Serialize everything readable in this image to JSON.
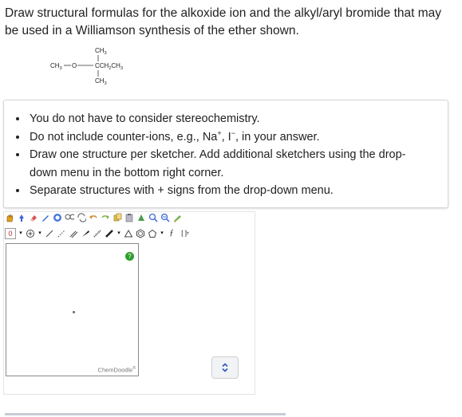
{
  "question": {
    "line1": "Draw structural formulas for the alkoxide ion and the alkyl/aryl bromide that may",
    "line2": "be used in a Williamson synthesis of the ether shown."
  },
  "molecule": {
    "top_label": "CH",
    "top_sub": "3",
    "left_label": "CH",
    "left_sub": "3",
    "oxygen": "O",
    "center_label_pre": "CCH",
    "center_sub1": "2",
    "center_label_post": "CH",
    "center_sub2": "3",
    "bottom_label": "CH",
    "bottom_sub": "3"
  },
  "instructions": {
    "items": [
      "You do not have to consider stereochemistry.",
      "Do not include counter-ions, e.g., Na",
      "Draw one structure per sketcher. Add additional sketchers using the drop-",
      "down menu in the bottom right corner.",
      "Separate structures with + signs from the drop-down menu."
    ],
    "item2_sup1": "+",
    "item2_mid": ", I",
    "item2_sup2": "−",
    "item2_end": ", in your answer."
  },
  "toolbar": {
    "row2_charge": "0",
    "row2_text_tool": "ƒ",
    "row2_bracket": "[ ]",
    "row2_bracket_sup": "±"
  },
  "sketcher": {
    "help": "?",
    "watermark": "ChemDoodle",
    "watermark_mark": "®"
  },
  "colors": {
    "accent": "#2a56c6",
    "help_green": "#2e9e2e",
    "border": "#d6d6d6"
  }
}
